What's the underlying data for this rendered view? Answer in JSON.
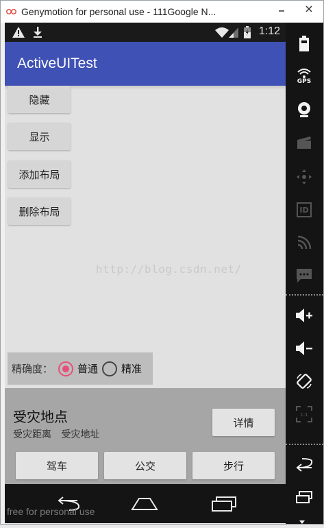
{
  "window": {
    "title": "Genymotion for personal use - 111Google N..."
  },
  "statusbar": {
    "time": "1:12"
  },
  "appbar": {
    "title": "ActiveUITest"
  },
  "buttons": {
    "hide": "隐藏",
    "show": "显示",
    "add_layout": "添加布局",
    "delete_layout": "删除布局"
  },
  "watermark": "http://blog.csdn.net/",
  "accuracy": {
    "label": "精确度：",
    "options": [
      "普通",
      "精准"
    ],
    "selected": "普通"
  },
  "place": {
    "name": "受灾地点",
    "distance": "受灾距离",
    "address": "受灾地址",
    "detail_label": "详情"
  },
  "modes": [
    "驾车",
    "公交",
    "步行"
  ],
  "navbar": {
    "overlay": "free for personal use"
  },
  "sidebar": {
    "gps_label": "GPS",
    "id_label": "ID"
  },
  "colors": {
    "appbar": "#3f51b5",
    "radio_accent": "#e94f7a"
  }
}
